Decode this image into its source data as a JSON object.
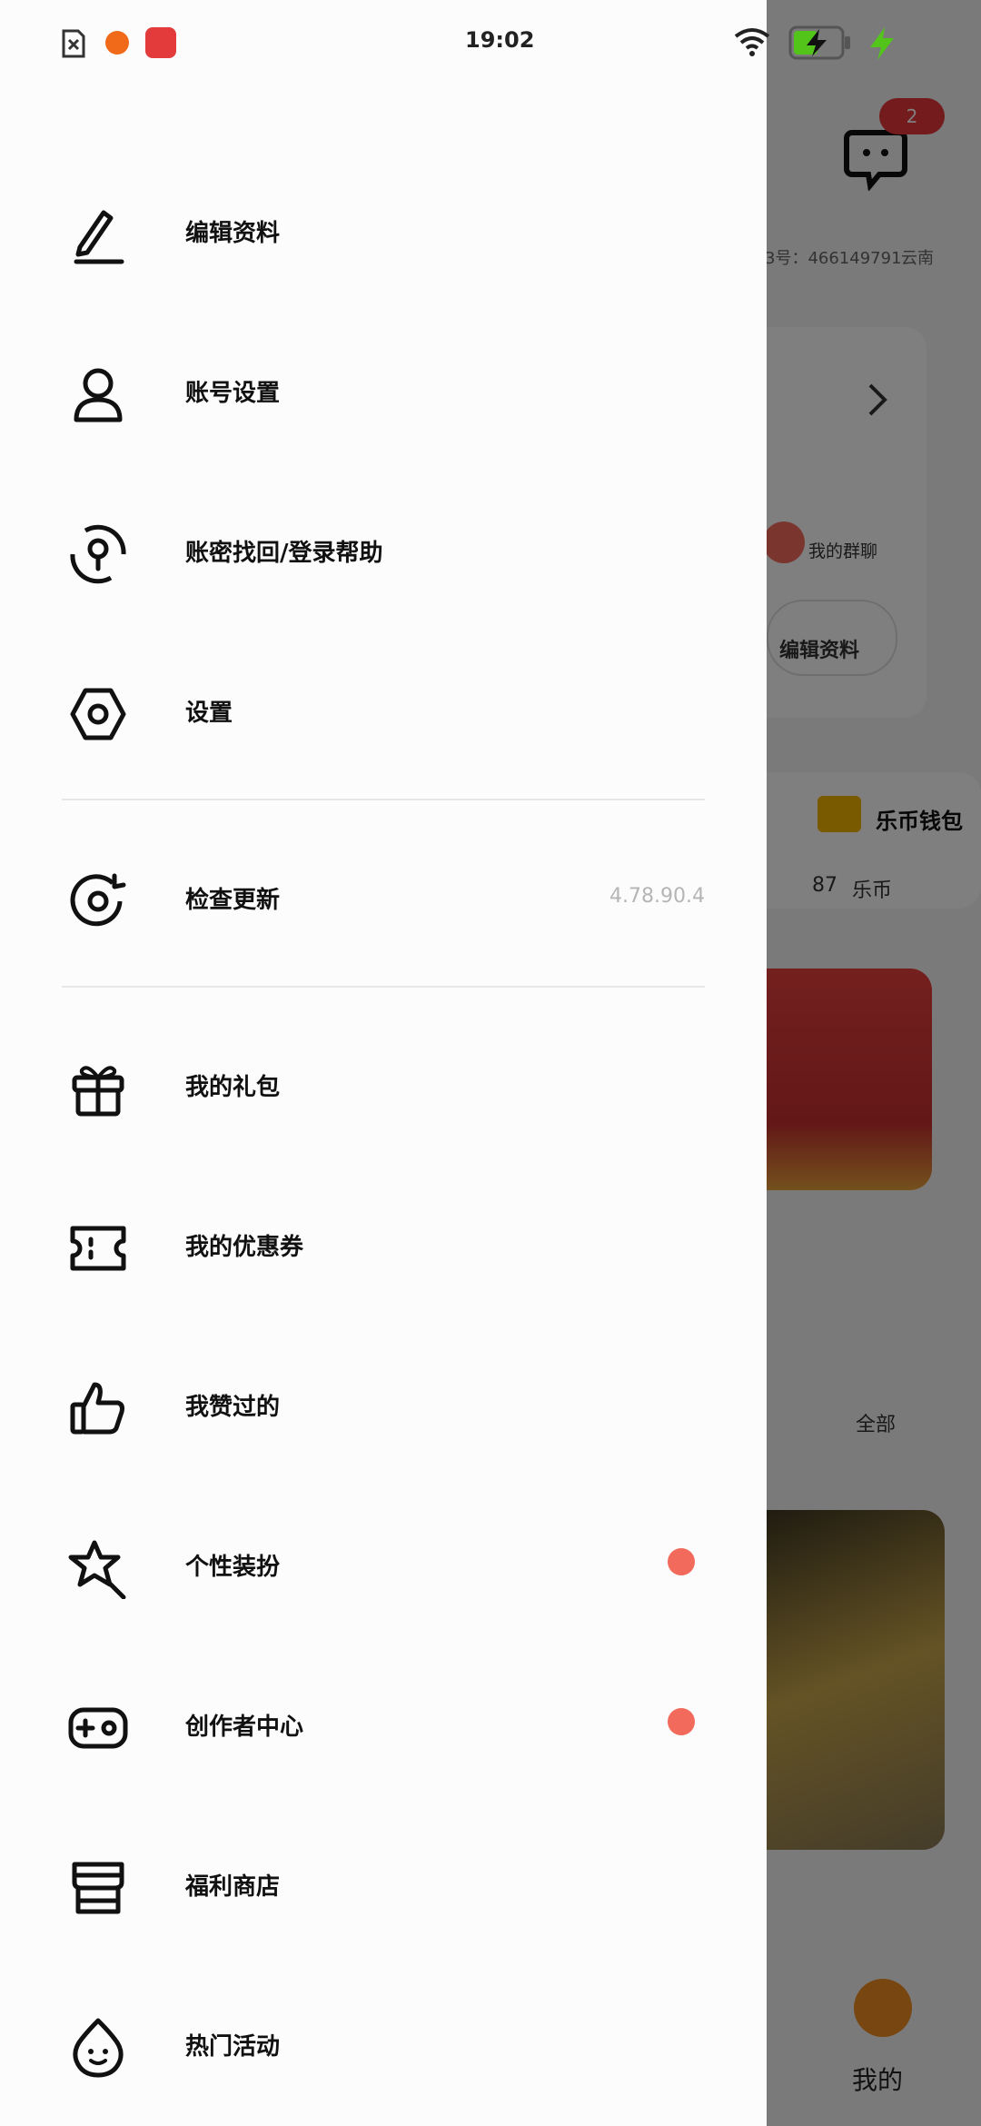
{
  "status_bar": {
    "time": "19:02"
  },
  "menu": {
    "items": [
      {
        "label": "编辑资料",
        "icon": "edit-icon"
      },
      {
        "label": "账号设置",
        "icon": "user-icon"
      },
      {
        "label": "账密找回/登录帮助",
        "icon": "key-recovery-icon"
      },
      {
        "label": "设置",
        "icon": "settings-hex-icon"
      },
      {
        "label": "检查更新",
        "icon": "update-icon",
        "value": "4.78.90.4"
      },
      {
        "label": "我的礼包",
        "icon": "gift-icon"
      },
      {
        "label": "我的优惠券",
        "icon": "coupon-icon"
      },
      {
        "label": "我赞过的",
        "icon": "thumbs-up-icon"
      },
      {
        "label": "个性装扮",
        "icon": "star-wand-icon",
        "badge": true
      },
      {
        "label": "创作者中心",
        "icon": "gamepad-icon",
        "badge": true
      },
      {
        "label": "福利商店",
        "icon": "store-icon"
      },
      {
        "label": "热门活动",
        "icon": "flame-face-icon"
      }
    ]
  },
  "background": {
    "message_badge": "2",
    "id_text": "3号：466149791",
    "region": "云南",
    "group_chat": "我的群聊",
    "edit_profile": "编辑资料",
    "wallet_title": "乐币钱包",
    "coins": "87",
    "coin_unit": "乐币",
    "filter_all": "全部",
    "nav_me": "我的"
  },
  "colors": {
    "badge_dot": "#f26a5c",
    "accent": "#ee8d23",
    "wallet_gold": "#f4b400"
  }
}
